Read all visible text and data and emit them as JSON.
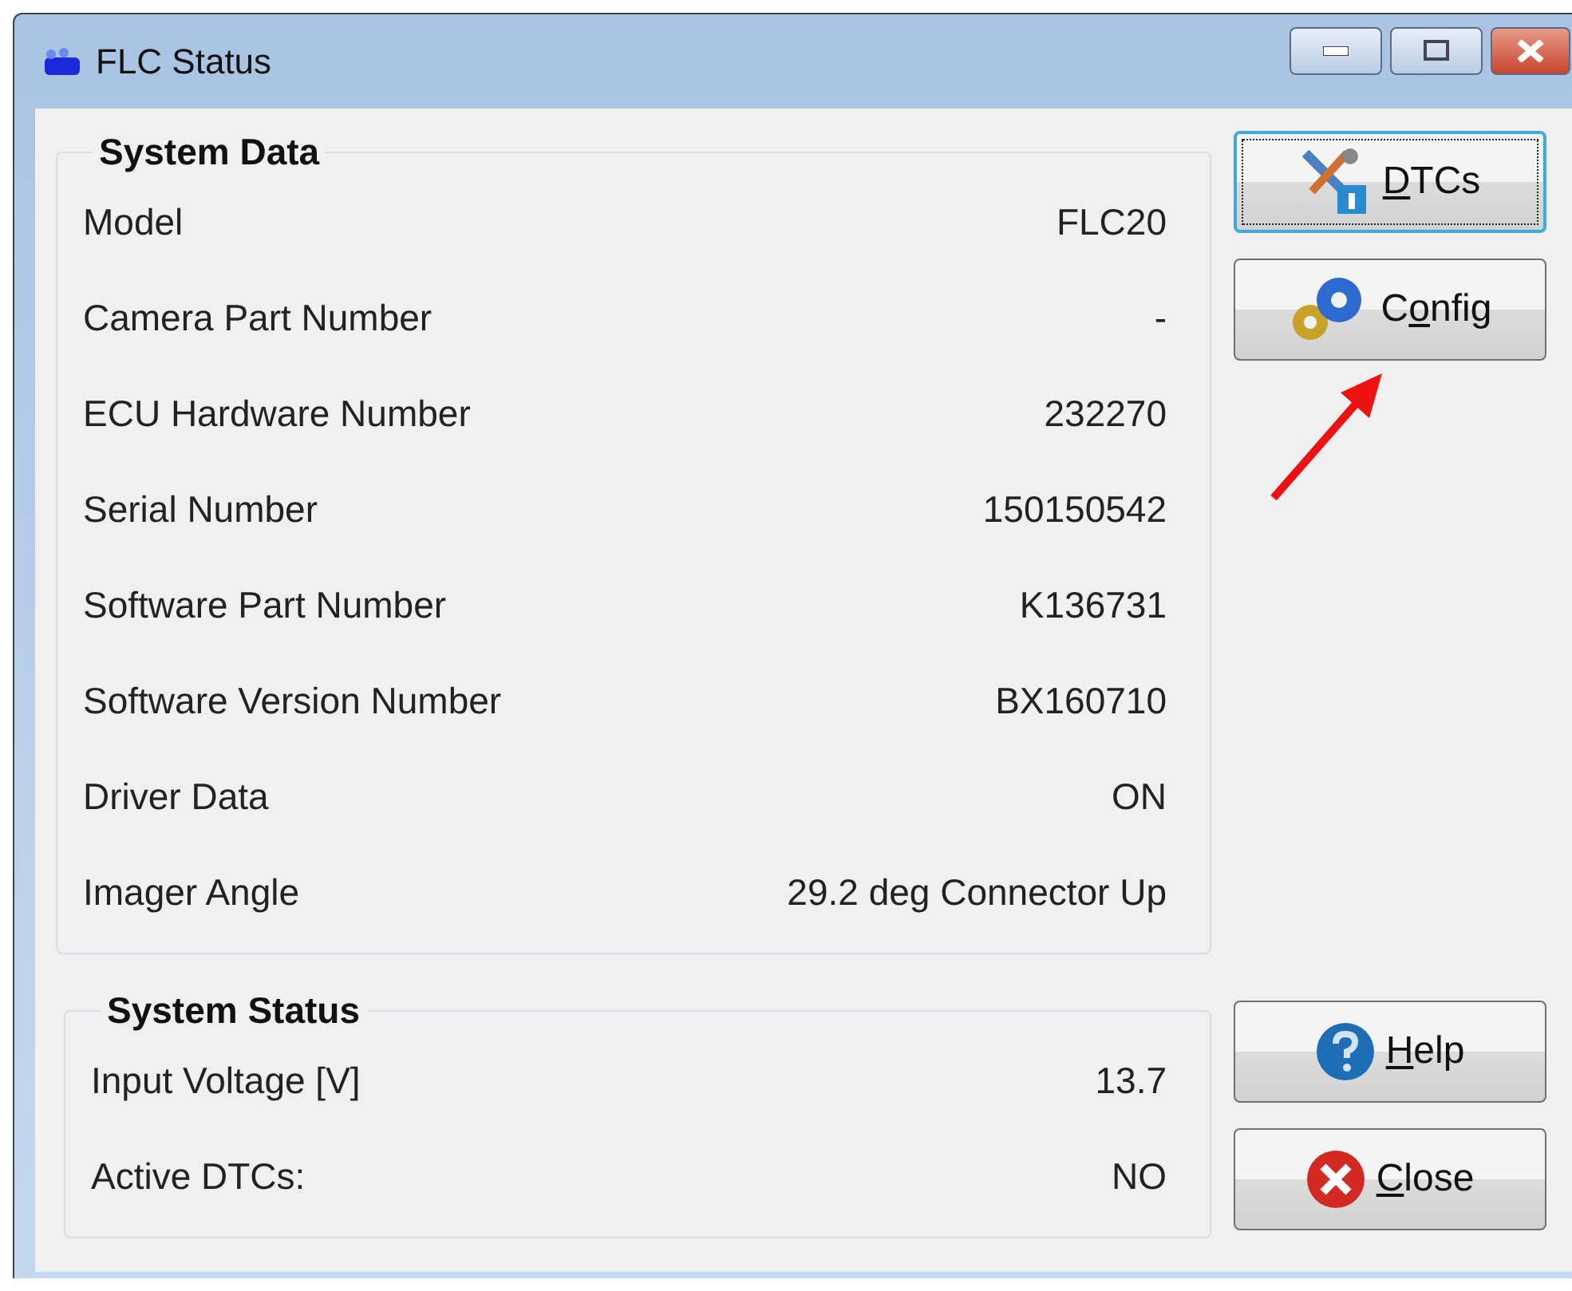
{
  "window": {
    "title": "FLC Status"
  },
  "groups": [
    {
      "title": "System Data",
      "rows": [
        {
          "label": "Model",
          "value": "FLC20"
        },
        {
          "label": "Camera Part Number",
          "value": "-"
        },
        {
          "label": "ECU Hardware Number",
          "value": "232270"
        },
        {
          "label": "Serial Number",
          "value": "150150542"
        },
        {
          "label": "Software Part Number",
          "value": "K136731"
        },
        {
          "label": "Software Version Number",
          "value": "BX160710"
        },
        {
          "label": "Driver Data",
          "value": "ON"
        },
        {
          "label": "Imager Angle",
          "value": "29.2 deg Connector Up"
        }
      ]
    },
    {
      "title": "System Status",
      "rows": [
        {
          "label": "Input Voltage [V]",
          "value": "13.7"
        },
        {
          "label": "Active DTCs:",
          "value": "NO"
        }
      ]
    }
  ],
  "top_buttons": [
    {
      "kind": "dtcs",
      "key": "D",
      "after": "TCs",
      "focused": true
    },
    {
      "kind": "config",
      "before": "C",
      "key": "o",
      "after": "nfig",
      "focused": false
    }
  ],
  "bottom_buttons": [
    {
      "kind": "help",
      "key": "H",
      "after": "elp",
      "focused": false
    },
    {
      "kind": "close",
      "key": "C",
      "after": "lose",
      "focused": false
    }
  ]
}
